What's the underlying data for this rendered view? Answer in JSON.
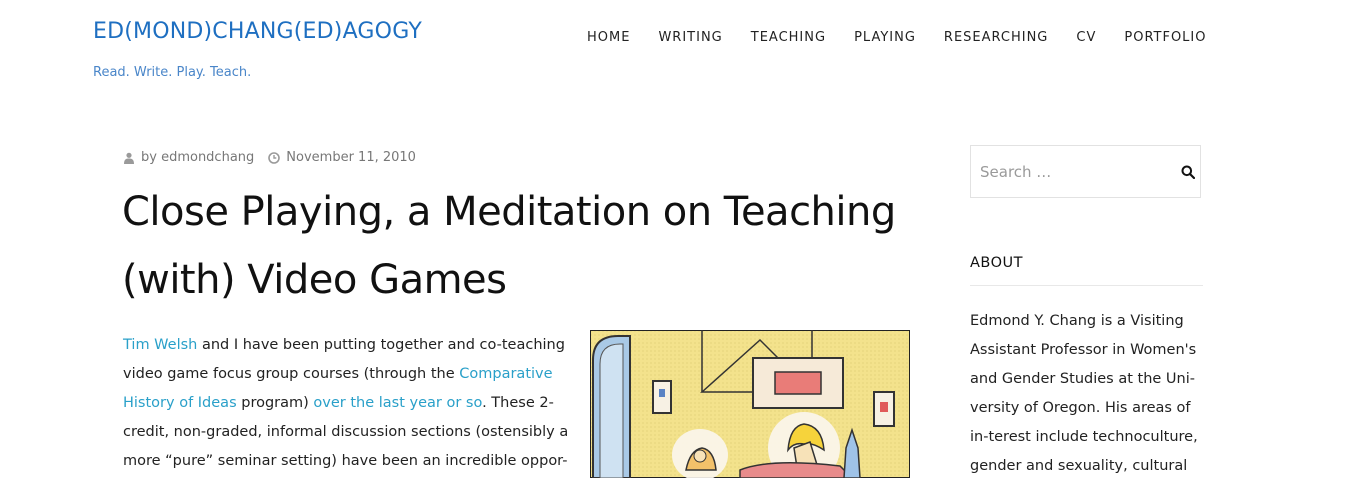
{
  "site": {
    "title": "ED(MOND)CHANG(ED)AGOGY",
    "tagline": "Read. Write. Play. Teach."
  },
  "nav": {
    "items": [
      "HOME",
      "WRITING",
      "TEACHING",
      "PLAYING",
      "RESEARCHING",
      "CV",
      "PORTFOLIO"
    ]
  },
  "post": {
    "author": "by edmondchang",
    "date": "November 11, 2010",
    "title": "Close Playing, a Meditation on Teaching (with) Video Games",
    "body": {
      "link1": "Tim Welsh",
      "text1": " and I have been putting together and co-teaching video game focus group courses (through the ",
      "link2": "Comparative History of Ideas",
      "text2": " program) ",
      "link3": "over the last year or so",
      "text3": ".  These 2-credit, non-graded, informal discussion sections (ostensibly a more “pure” seminar setting) have been an incredible oppor-"
    }
  },
  "sidebar": {
    "search_placeholder": "Search …",
    "about_title": "ABOUT",
    "about_text": "Edmond Y. Chang is a Visiting Assistant Professor in Women's and Gender Studies at the Uni-versity of Oregon. His areas of in-terest include technoculture, gender and sexuality, cultural"
  },
  "colors": {
    "title_blue": "#1e6fc1",
    "link_blue": "#2aa0c9"
  },
  "icons": [
    "user-icon",
    "clock-icon",
    "search-icon"
  ]
}
